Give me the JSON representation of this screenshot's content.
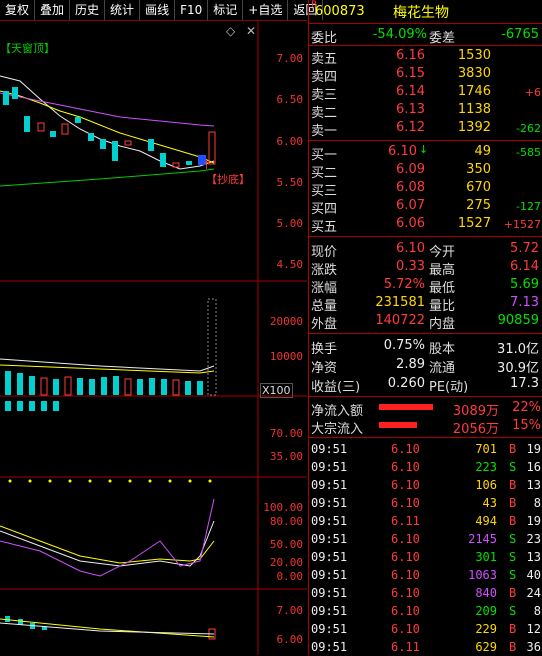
{
  "toolbar": {
    "items": [
      "复权",
      "叠加",
      "历史",
      "统计",
      "画线",
      "F10",
      "标记",
      "+自选",
      "返回"
    ]
  },
  "chart": {
    "price_axis": [
      "7.00",
      "6.50",
      "6.00",
      "5.50",
      "5.00",
      "4.50"
    ],
    "vol_axis": [
      "20000",
      "10000"
    ],
    "vol_unit": "X100",
    "ind1_axis": [
      "70.00",
      "35.00"
    ],
    "kdj_axis": [
      "100.00",
      "80.00",
      "50.00",
      "20.00",
      "0.00"
    ],
    "mini_axis": [
      "7.00",
      "6.00"
    ],
    "annotation_top": "【天窗顶】",
    "annotation_buy": "【抄底】"
  },
  "stock": {
    "marker": "R",
    "code": "600873",
    "name": "梅花生物"
  },
  "weibi": {
    "label": "委比",
    "value": "-54.09%",
    "label2": "委差",
    "value2": "-6765"
  },
  "asks": [
    {
      "label": "卖五",
      "price": "6.16",
      "vol": "1530",
      "chg": ""
    },
    {
      "label": "卖四",
      "price": "6.15",
      "vol": "3830",
      "chg": ""
    },
    {
      "label": "卖三",
      "price": "6.14",
      "vol": "1746",
      "chg": "+6"
    },
    {
      "label": "卖二",
      "price": "6.13",
      "vol": "1138",
      "chg": ""
    },
    {
      "label": "卖一",
      "price": "6.12",
      "vol": "1392",
      "chg": "-262"
    }
  ],
  "bids": [
    {
      "label": "买一",
      "price": "6.10",
      "vol": "49",
      "chg": "-585"
    },
    {
      "label": "买二",
      "price": "6.09",
      "vol": "350",
      "chg": ""
    },
    {
      "label": "买三",
      "price": "6.08",
      "vol": "670",
      "chg": ""
    },
    {
      "label": "买四",
      "price": "6.07",
      "vol": "275",
      "chg": "-127"
    },
    {
      "label": "买五",
      "price": "6.06",
      "vol": "1527",
      "chg": "+1527"
    }
  ],
  "quote": [
    {
      "l1": "现价",
      "v1": "6.10",
      "l2": "今开",
      "v2": "5.72"
    },
    {
      "l1": "涨跌",
      "v1": "0.33",
      "l2": "最高",
      "v2": "6.14"
    },
    {
      "l1": "涨幅",
      "v1": "5.72%",
      "l2": "最低",
      "v2": "5.69"
    },
    {
      "l1": "总量",
      "v1": "231581",
      "l2": "量比",
      "v2": "7.13"
    },
    {
      "l1": "外盘",
      "v1": "140722",
      "l2": "内盘",
      "v2": "90859"
    }
  ],
  "stats": [
    {
      "l1": "换手",
      "v1": "0.75%",
      "l2": "股本",
      "v2": "31.0亿"
    },
    {
      "l1": "净资",
      "v1": "2.89",
      "l2": "流通",
      "v2": "30.9亿"
    },
    {
      "l1": "收益(三)",
      "v1": "0.260",
      "l2": "PE(动)",
      "v2": "17.3"
    }
  ],
  "flow": [
    {
      "label": "净流入额",
      "value": "3089万",
      "pct": "22%",
      "bar": 0.8
    },
    {
      "label": "大宗流入",
      "value": "2056万",
      "pct": "15%",
      "bar": 0.55
    }
  ],
  "ticks": [
    {
      "time": "09:51",
      "price": "6.10",
      "vol": "701",
      "side": "B",
      "n": "19"
    },
    {
      "time": "09:51",
      "price": "6.10",
      "vol": "223",
      "side": "S",
      "n": "16"
    },
    {
      "time": "09:51",
      "price": "6.10",
      "vol": "106",
      "side": "B",
      "n": "13"
    },
    {
      "time": "09:51",
      "price": "6.10",
      "vol": "43",
      "side": "B",
      "n": "8"
    },
    {
      "time": "09:51",
      "price": "6.11",
      "vol": "494",
      "side": "B",
      "n": "19"
    },
    {
      "time": "09:51",
      "price": "6.10",
      "vol": "2145",
      "side": "S",
      "n": "23"
    },
    {
      "time": "09:51",
      "price": "6.10",
      "vol": "301",
      "side": "S",
      "n": "13"
    },
    {
      "time": "09:51",
      "price": "6.10",
      "vol": "1063",
      "side": "S",
      "n": "40"
    },
    {
      "time": "09:51",
      "price": "6.10",
      "vol": "840",
      "side": "B",
      "n": "24"
    },
    {
      "time": "09:51",
      "price": "6.10",
      "vol": "209",
      "side": "S",
      "n": "8"
    },
    {
      "time": "09:51",
      "price": "6.10",
      "vol": "229",
      "side": "B",
      "n": "12"
    },
    {
      "time": "09:51",
      "price": "6.11",
      "vol": "629",
      "side": "B",
      "n": "36"
    }
  ]
}
